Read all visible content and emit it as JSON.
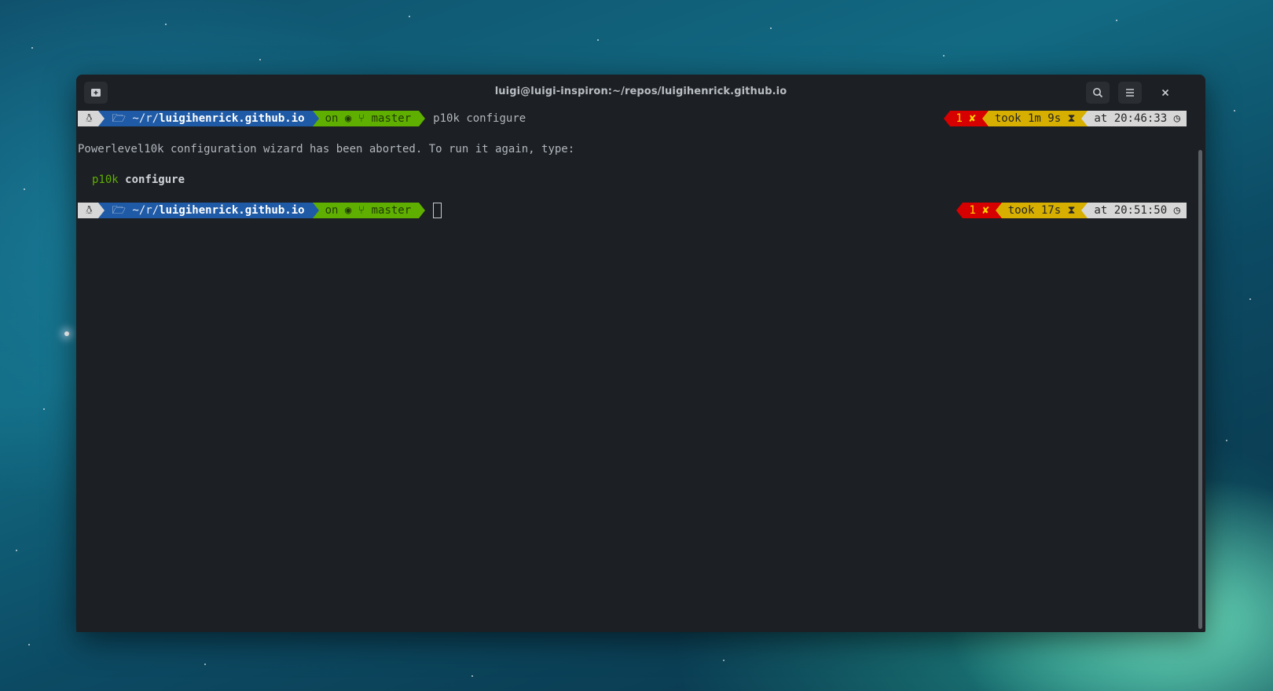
{
  "window": {
    "title": "luigi@luigi-inspiron:~/repos/luigihenrick.github.io"
  },
  "icons": {
    "new_tab": "new-tab-icon",
    "search": "search-icon",
    "menu": "hamburger-menu-icon",
    "close": "close-icon",
    "os": "linux-penguin-icon",
    "folder": "folder-icon",
    "github": "github-icon",
    "branch": "git-branch-icon",
    "error": "cross-icon",
    "hourglass": "hourglass-icon",
    "clock": "clock-icon"
  },
  "prompt1": {
    "dir_prefix": "~/r/",
    "dir_name": "luigihenrick.github.io",
    "git_on": "on",
    "branch": "master",
    "command": "p10k configure",
    "status": "1",
    "took": "took 1m 9s",
    "at": "at 20:46:33"
  },
  "output": {
    "message": "Powerlevel10k configuration wizard has been aborted. To run it again, type:",
    "hint_cmd": "p10k",
    "hint_arg": "configure"
  },
  "prompt2": {
    "dir_prefix": "~/r/",
    "dir_name": "luigihenrick.github.io",
    "git_on": "on",
    "branch": "master",
    "status": "1",
    "took": "took 17s",
    "at": "at 20:51:50"
  },
  "colors": {
    "os_segment": "#d7d7d7",
    "dir_segment": "#1e5aa6",
    "git_segment": "#5faf00",
    "error_segment": "#d70000",
    "took_segment": "#d7af00",
    "time_segment": "#d7d7d7",
    "terminal_bg": "#1c1f23"
  }
}
